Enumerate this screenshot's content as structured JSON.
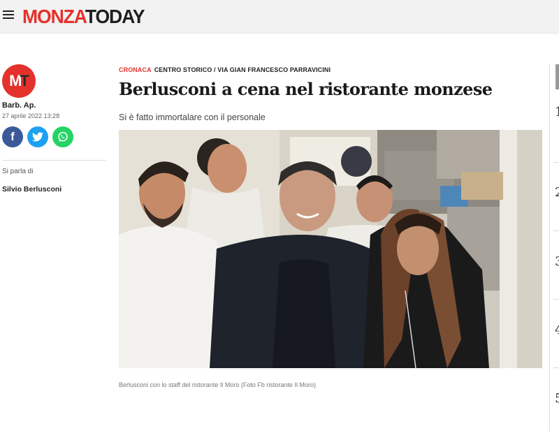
{
  "header": {
    "logo_part1": "MONZA",
    "logo_part2": "TODAY",
    "menu_icon": "hamburger-menu-icon"
  },
  "author": {
    "initial_1": "M",
    "initial_2": "T",
    "name": "Barb. Ap.",
    "date": "27 aprile 2022 13:28"
  },
  "share": {
    "facebook_icon": "facebook-icon",
    "twitter_icon": "twitter-icon",
    "whatsapp_icon": "whatsapp-icon"
  },
  "topics": {
    "label": "Si parla di",
    "tag": "Silvio Berlusconi"
  },
  "article": {
    "category": "CRONACA",
    "location": "CENTRO STORICO / VIA GIAN FRANCESCO PARRAVICINI",
    "title": "Berlusconi a cena nel ristorante monzese",
    "subtitle": "Si è fatto immortalare con il personale",
    "caption": "Berlusconi con lo staff del ristorante Il Moro (Foto Fb ristorante Il Moro)"
  },
  "rail": {
    "numbers": [
      "1",
      "2",
      "3",
      "4",
      "5"
    ]
  },
  "colors": {
    "brand_red": "#e5312b",
    "facebook": "#3b5998",
    "twitter": "#1da1f2",
    "whatsapp": "#25d366"
  }
}
